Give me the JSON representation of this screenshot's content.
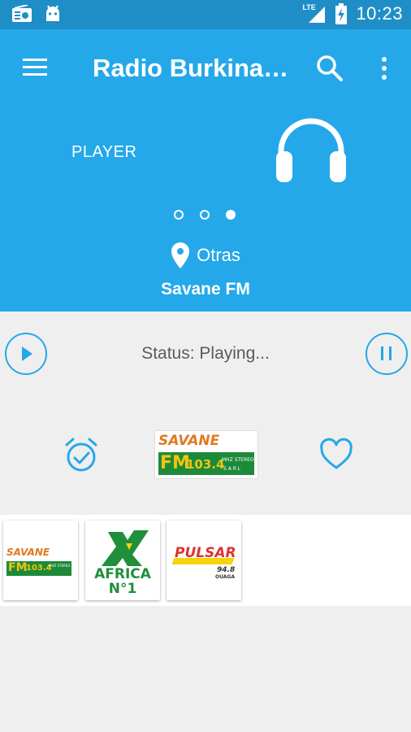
{
  "status_bar": {
    "network": "LTE",
    "time": "10:23"
  },
  "toolbar": {
    "title": "Radio Burkina…"
  },
  "pager": {
    "label": "PLAYER",
    "pages": 3,
    "active_page": 3
  },
  "location": {
    "text": "Otras"
  },
  "station": {
    "name": "Savane FM"
  },
  "player": {
    "status": "Status: Playing..."
  },
  "logos": {
    "savane": {
      "word": "SAVANE",
      "fm": "FM",
      "freq": "103.4",
      "suffix": "MHZ STEREO",
      "sub": "S A R L"
    },
    "africa": {
      "line1": "AFRICA",
      "line2": "N°1"
    },
    "pulsar": {
      "word": "PULSAR",
      "freq": "94.8",
      "city": "OUAGA"
    }
  },
  "colors": {
    "accent": "#25a8ea",
    "status_bar": "#1f8ec7",
    "savane_green": "#1d8a3a",
    "savane_orange": "#e07a1f",
    "africa_green": "#1f8f3a",
    "pulsar_red": "#e0322b",
    "pulsar_yellow": "#f5d30f"
  }
}
